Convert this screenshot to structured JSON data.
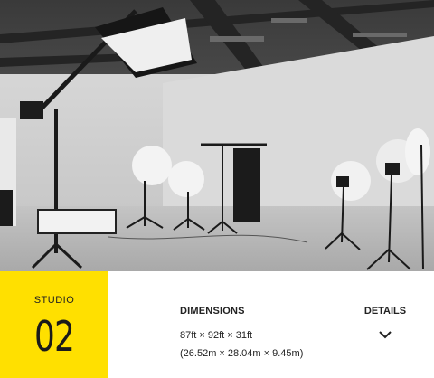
{
  "photo": {
    "alt_icon": "studio-photo"
  },
  "badge": {
    "label": "STUDIO",
    "number": "02",
    "color": "#ffe000"
  },
  "dimensions": {
    "title": "DIMENSIONS",
    "imperial": "87ft × 92ft × 31ft",
    "metric": "(26.52m × 28.04m × 9.45m)"
  },
  "details": {
    "label": "DETAILS",
    "icon": "chevron-down-icon"
  }
}
